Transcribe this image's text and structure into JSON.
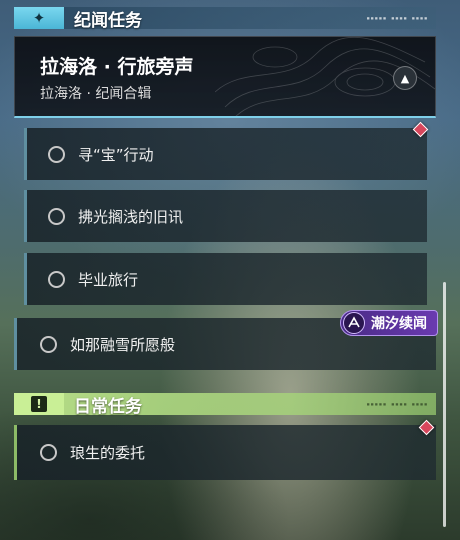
{
  "sections": {
    "story": {
      "title": "纪闻任务",
      "icon": "diamond-star-icon",
      "accent": "#7ad7ef"
    },
    "daily": {
      "title": "日常任务",
      "icon": "exclamation-box-icon",
      "accent": "#c9ef96"
    }
  },
  "chain": {
    "title": "拉海洛 · 行旅旁声",
    "subtitle": "拉海洛 · 纪闻合辑",
    "collapse_icon": "chevron-up-icon"
  },
  "quests": [
    {
      "label": "寻“宝”行动"
    },
    {
      "label": "拂光搁浅的旧讯"
    },
    {
      "label": "毕业旅行"
    },
    {
      "label": "如那融雪所愿般"
    },
    {
      "label": "琅生的委托"
    }
  ],
  "series_badge": {
    "label": "潮汐续闻",
    "color": "#6a3ab0"
  },
  "tracker_color": "#d7465c"
}
